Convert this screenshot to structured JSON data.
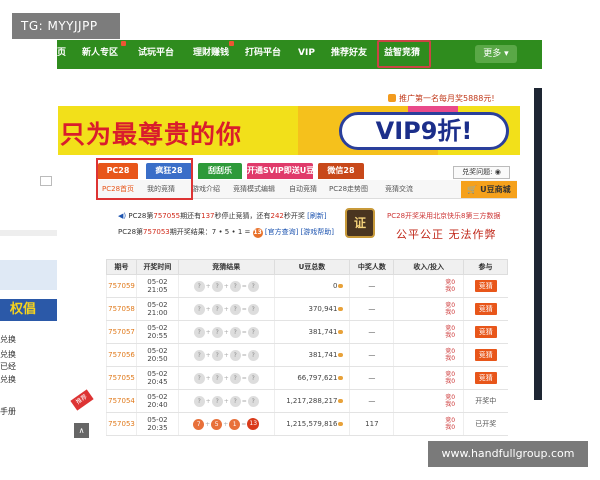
{
  "watermark_top": "TG: MYYJJPP",
  "watermark_bottom": "www.handfullgroup.com",
  "nav": {
    "items": [
      {
        "label": "页"
      },
      {
        "label": "新人专区"
      },
      {
        "label": "试玩平台"
      },
      {
        "label": "理财赚钱"
      },
      {
        "label": "打码平台"
      },
      {
        "label": "VIP"
      },
      {
        "label": "推荐好友"
      },
      {
        "label": "益智竞猜"
      }
    ],
    "more_label": "更多"
  },
  "promo_text": "推广第一名每月奖5888元!",
  "banner": {
    "left_text": "只为最尊贵的你",
    "vip_text": "VIP9折!"
  },
  "tabs": [
    {
      "label": "PC28",
      "color": "#e8561a"
    },
    {
      "label": "疯狂28",
      "color": "#3a6ec8"
    },
    {
      "label": "刮刮乐",
      "color": "#2e9a3a"
    },
    {
      "label": "开通SVIP即送U豆",
      "color": "#e03a6a"
    },
    {
      "label": "微信28",
      "color": "#c8481a"
    }
  ],
  "exchange_label": "兑奖问题:",
  "subnav": [
    "PC28首页",
    "我的竞猜",
    "游戏介绍",
    "竞猜模式编辑",
    "自动竞猜",
    "PC28走势图",
    "竞猜交流"
  ],
  "shop_label": "U豆商城",
  "info": {
    "line1_prefix": "PC28第",
    "line1_issue": "757055",
    "line1_mid": "期还有",
    "line1_seconds": "137",
    "line1_mid2": "秒停止竞猜，还有",
    "line1_seconds2": "242",
    "line1_tail": "秒开奖",
    "line1_refresh": "刷新",
    "line2_prefix": "PC28第",
    "line2_issue": "757053",
    "line2_mid": "期开奖结果：7 • 5 • 1 =",
    "line2_result": "13",
    "line2_links": "[官方查询] [游戏帮助]"
  },
  "fair": {
    "top": "PC28开奖采用北京快乐8第三方数据",
    "slogan": "公平公正  无法作弊"
  },
  "table": {
    "headers": [
      "期号",
      "开奖时间",
      "竞猜结果",
      "U豆总数",
      "中奖人数",
      "收入/投入",
      "参与"
    ],
    "rows": [
      {
        "id": "757059",
        "date": "05-02",
        "time": "21:05",
        "balls": [
          "?",
          "?",
          "?",
          "?"
        ],
        "total": "0",
        "winners": "—",
        "income": "竞0",
        "invest": "我0",
        "action": "竞猜"
      },
      {
        "id": "757058",
        "date": "05-02",
        "time": "21:00",
        "balls": [
          "?",
          "?",
          "?",
          "?"
        ],
        "total": "370,941",
        "winners": "—",
        "income": "竞0",
        "invest": "我0",
        "action": "竞猜"
      },
      {
        "id": "757057",
        "date": "05-02",
        "time": "20:55",
        "balls": [
          "?",
          "?",
          "?",
          "?"
        ],
        "total": "381,741",
        "winners": "—",
        "income": "竞0",
        "invest": "我0",
        "action": "竞猜"
      },
      {
        "id": "757056",
        "date": "05-02",
        "time": "20:50",
        "balls": [
          "?",
          "?",
          "?",
          "?"
        ],
        "total": "381,741",
        "winners": "—",
        "income": "竞0",
        "invest": "我0",
        "action": "竞猜"
      },
      {
        "id": "757055",
        "date": "05-02",
        "time": "20:45",
        "balls": [
          "?",
          "?",
          "?",
          "?"
        ],
        "total": "66,797,621",
        "winners": "—",
        "income": "竞0",
        "invest": "我0",
        "action": "竞猜"
      },
      {
        "id": "757054",
        "date": "05-02",
        "time": "20:40",
        "balls": [
          "?",
          "?",
          "?",
          "?"
        ],
        "total": "1,217,288,217",
        "winners": "—",
        "income": "竞0",
        "invest": "我0",
        "action": "开奖中"
      },
      {
        "id": "757053",
        "date": "05-02",
        "time": "20:35",
        "balls": [
          "7",
          "5",
          "1",
          "13"
        ],
        "total": "1,215,579,816",
        "winners": "117",
        "income": "竞0",
        "invest": "我0",
        "action": "已开奖"
      }
    ]
  },
  "left_sidebar": {
    "lines": [
      "兑换",
      "兑换",
      "已经",
      "兑换",
      "手册"
    ],
    "orange_text": "权倡",
    "ribbon": "推荐"
  }
}
